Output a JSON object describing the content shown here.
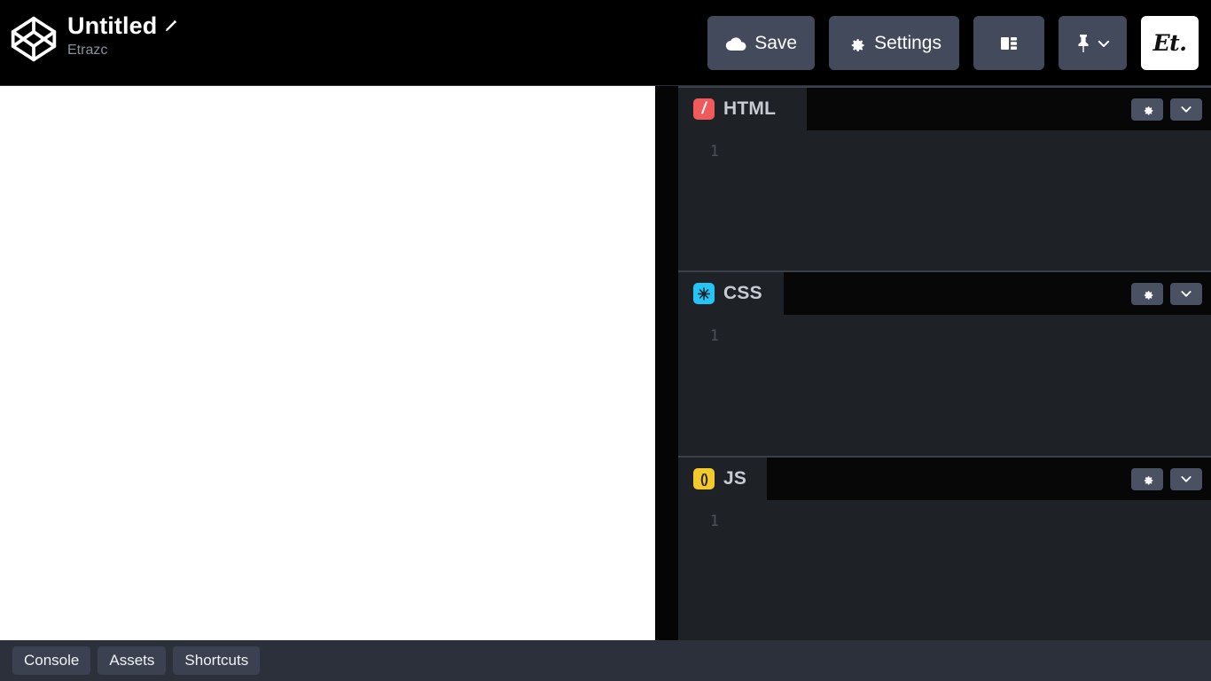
{
  "app": {
    "name": "CodePen Editor",
    "logo_icon": "codepen-logo-icon"
  },
  "header": {
    "pen_title": "Untitled",
    "edit_icon": "pencil-icon",
    "author": "Etrazc",
    "actions": {
      "save_label": "Save",
      "save_icon": "cloud-icon",
      "settings_label": "Settings",
      "settings_icon": "gear-icon",
      "layout_icon": "layout-columns-icon",
      "pin_icon": "pin-icon",
      "pin_chevron_icon": "chevron-down-icon",
      "avatar_label": "Et."
    }
  },
  "main": {
    "preview": {
      "background": "#ffffff",
      "content": ""
    },
    "editors": [
      {
        "id": "html",
        "label": "HTML",
        "badge_glyph": "/",
        "badge_color": "#f15a5a",
        "badge_icon": "html-slash-icon",
        "settings_icon": "gear-icon",
        "collapse_icon": "chevron-down-icon",
        "line_number": "1",
        "code": ""
      },
      {
        "id": "css",
        "label": "CSS",
        "badge_glyph": "✳",
        "badge_color": "#24c4f4",
        "badge_icon": "css-asterisk-icon",
        "settings_icon": "gear-icon",
        "collapse_icon": "chevron-down-icon",
        "line_number": "1",
        "code": ""
      },
      {
        "id": "js",
        "label": "JS",
        "badge_glyph": "()",
        "badge_color": "#f2ca2c",
        "badge_icon": "js-parens-icon",
        "settings_icon": "gear-icon",
        "collapse_icon": "chevron-down-icon",
        "line_number": "1",
        "code": ""
      }
    ]
  },
  "footer": {
    "console_label": "Console",
    "assets_label": "Assets",
    "shortcuts_label": "Shortcuts"
  },
  "colors": {
    "header_bg": "#000000",
    "editor_bg": "#1e2126",
    "panel_head_bg": "#070707",
    "footer_bg": "#2b303b",
    "button_bg": "#434a5c",
    "accent_html": "#f15a5a",
    "accent_css": "#24c4f4",
    "accent_js": "#f2ca2c"
  }
}
